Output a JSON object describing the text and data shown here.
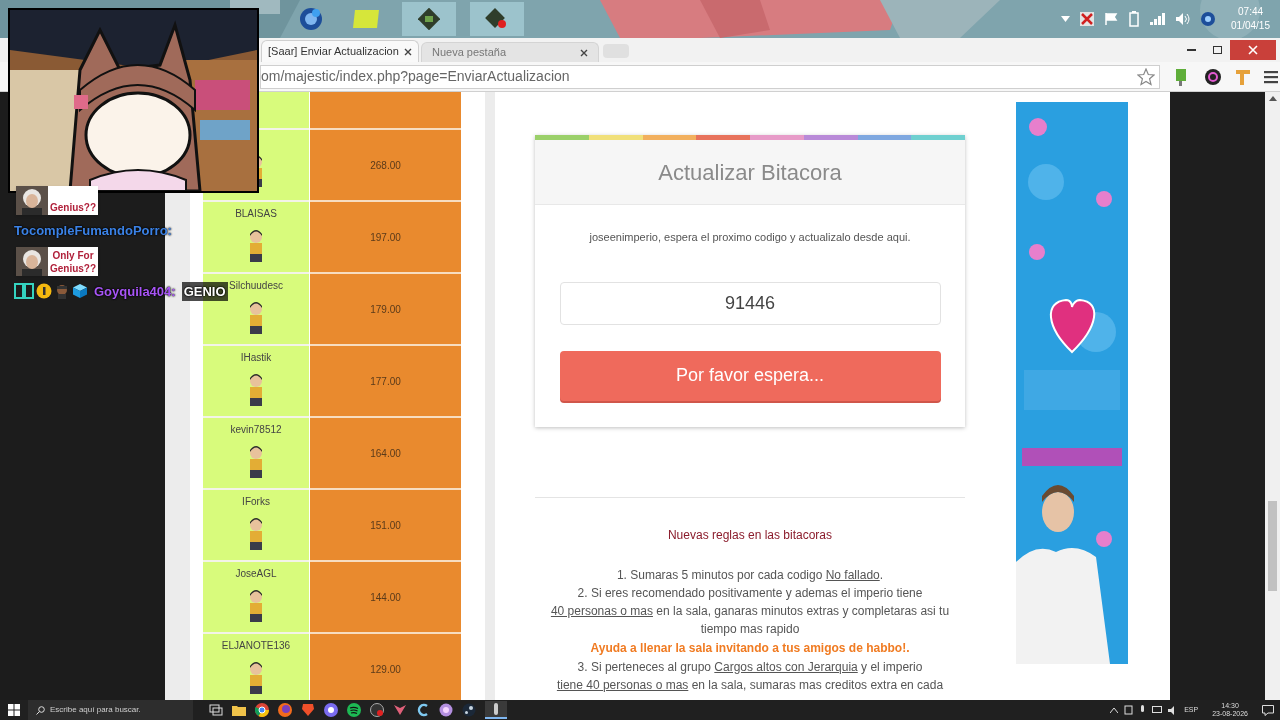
{
  "tray": {
    "time": "07:44",
    "date": "01/04/15"
  },
  "browser": {
    "tabs": [
      {
        "title": "[Saar] Enviar Actualizacion",
        "selected": true
      },
      {
        "title": "Nueva pestaña",
        "selected": false
      }
    ],
    "address": "om/majestic/index.php?page=EnviarActualizacion"
  },
  "ranking": {
    "rows": [
      {
        "value": "268.00"
      },
      {
        "name": "BLAISAS",
        "value": "197.00"
      },
      {
        "name": "Silchuudesc",
        "value": "179.00"
      },
      {
        "name": "IHastik",
        "value": "177.00"
      },
      {
        "name": "kevin78512",
        "value": "164.00"
      },
      {
        "name": "IForks",
        "value": "151.00"
      },
      {
        "name": "JoseAGL",
        "value": "144.00"
      },
      {
        "name": "ELJANOTE136",
        "value": "129.00"
      }
    ]
  },
  "card": {
    "title": "Actualizar Bitacora",
    "message": "joseenimperio, espera el proximo codigo y actualizalo desde aqui.",
    "code": "91446",
    "button": "Por favor espera..."
  },
  "rules": {
    "heading": "Nuevas reglas en las bitacoras",
    "items": [
      {
        "kind": "rule",
        "segments": [
          {
            "text": "1. Sumaras 5 minutos por cada codigo ",
            "underline": false
          },
          {
            "text": "No fallado",
            "underline": true
          },
          {
            "text": ".",
            "underline": false
          }
        ]
      },
      {
        "kind": "rule",
        "segments": [
          {
            "text": "2. Si eres recomendado positivamente y ademas el imperio tiene ",
            "underline": false
          },
          {
            "text": "40 personas o mas",
            "underline": true
          },
          {
            "text": " en la sala, ganaras minutos extras y completaras asi tu tiempo mas rapido",
            "underline": false
          }
        ]
      },
      {
        "kind": "notice",
        "segments": [
          {
            "text": "Ayuda a llenar la sala invitando a tus amigos de habbo!.",
            "underline": false
          }
        ]
      },
      {
        "kind": "rule",
        "segments": [
          {
            "text": "3. Si perteneces al grupo ",
            "underline": false
          },
          {
            "text": "Cargos altos con Jerarquia",
            "underline": true
          },
          {
            "text": " y el imperio ",
            "underline": false
          },
          {
            "text": "tiene 40 personas o mas",
            "underline": true
          },
          {
            "text": " en la sala, sumaras mas creditos extra en cada",
            "underline": false
          }
        ]
      }
    ]
  },
  "chat": [
    {
      "kind": "emote",
      "lines": [
        "Genius??"
      ]
    },
    {
      "kind": "user",
      "user": "TocompleFumandoPorro:",
      "color": "#3b82e6"
    },
    {
      "kind": "emote",
      "lines": [
        "Only For",
        "Genius??"
      ]
    },
    {
      "kind": "message",
      "user": "Goyquila404:",
      "color": "#a855f7",
      "text": "GENIO"
    }
  ],
  "taskbar": {
    "search_placeholder": "Escribe aquí para buscar.",
    "language": "ESP",
    "time": "14:30",
    "date": "23-08-2026"
  }
}
